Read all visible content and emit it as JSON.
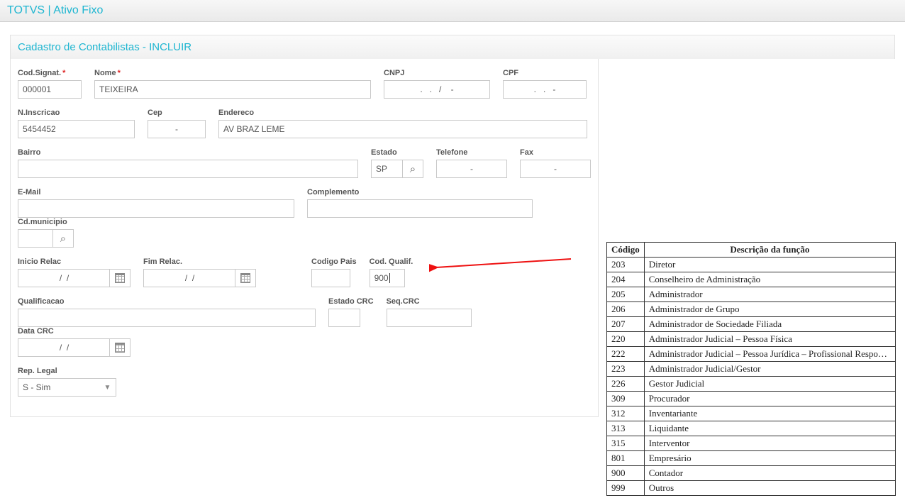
{
  "app": {
    "title": "TOTVS | Ativo Fixo",
    "pageTitle": "Cadastro de Contabilistas - INCLUIR"
  },
  "labels": {
    "codSignat": "Cod.Signat.",
    "nome": "Nome",
    "cnpj": "CNPJ",
    "cpf": "CPF",
    "nInscricao": "N.Inscricao",
    "cep": "Cep",
    "endereco": "Endereco",
    "bairro": "Bairro",
    "estado": "Estado",
    "telefone": "Telefone",
    "fax": "Fax",
    "email": "E-Mail",
    "complemento": "Complemento",
    "cdMunicipio": "Cd.municipio",
    "inicioRelac": "Inicio Relac",
    "fimRelac": "Fim Relac.",
    "codigoPais": "Codigo Pais",
    "codQualif": "Cod. Qualif.",
    "qualificacao": "Qualificacao",
    "estadoCrc": "Estado CRC",
    "seqCrc": "Seq.CRC",
    "dataCrc": "Data CRC",
    "repLegal": "Rep. Legal",
    "required": "*"
  },
  "values": {
    "codSignat": "000001",
    "nome": "TEIXEIRA",
    "cnpj": ".   .   /    -",
    "cpf": ".   .   -",
    "nInscricao": "5454452",
    "cep": "-",
    "endereco": "AV BRAZ LEME",
    "bairro": "",
    "estado": "SP",
    "telefone": "-",
    "fax": "-",
    "email": "",
    "complemento": "",
    "cdMunicipio": "",
    "inicioRelac": "/  /",
    "fimRelac": "/  /",
    "codigoPais": "",
    "codQualif": "900",
    "qualificacao": "",
    "estadoCrc": "",
    "seqCrc": "",
    "dataCrc": "/  /",
    "repLegal": "S - Sim"
  },
  "codesTable": {
    "headers": {
      "code": "Código",
      "desc": "Descrição da função"
    },
    "rows": [
      {
        "code": "203",
        "desc": "Diretor"
      },
      {
        "code": "204",
        "desc": "Conselheiro de Administração"
      },
      {
        "code": "205",
        "desc": "Administrador"
      },
      {
        "code": "206",
        "desc": "Administrador de Grupo"
      },
      {
        "code": "207",
        "desc": "Administrador de Sociedade Filiada"
      },
      {
        "code": "220",
        "desc": "Administrador Judicial – Pessoa Física"
      },
      {
        "code": "222",
        "desc": "Administrador Judicial – Pessoa Jurídica – Profissional Responsável"
      },
      {
        "code": "223",
        "desc": "Administrador Judicial/Gestor"
      },
      {
        "code": "226",
        "desc": "Gestor Judicial"
      },
      {
        "code": "309",
        "desc": "Procurador"
      },
      {
        "code": "312",
        "desc": "Inventariante"
      },
      {
        "code": "313",
        "desc": "Liquidante"
      },
      {
        "code": "315",
        "desc": "Interventor"
      },
      {
        "code": "801",
        "desc": "Empresário"
      },
      {
        "code": "900",
        "desc": "Contador"
      },
      {
        "code": "999",
        "desc": "Outros"
      }
    ]
  }
}
